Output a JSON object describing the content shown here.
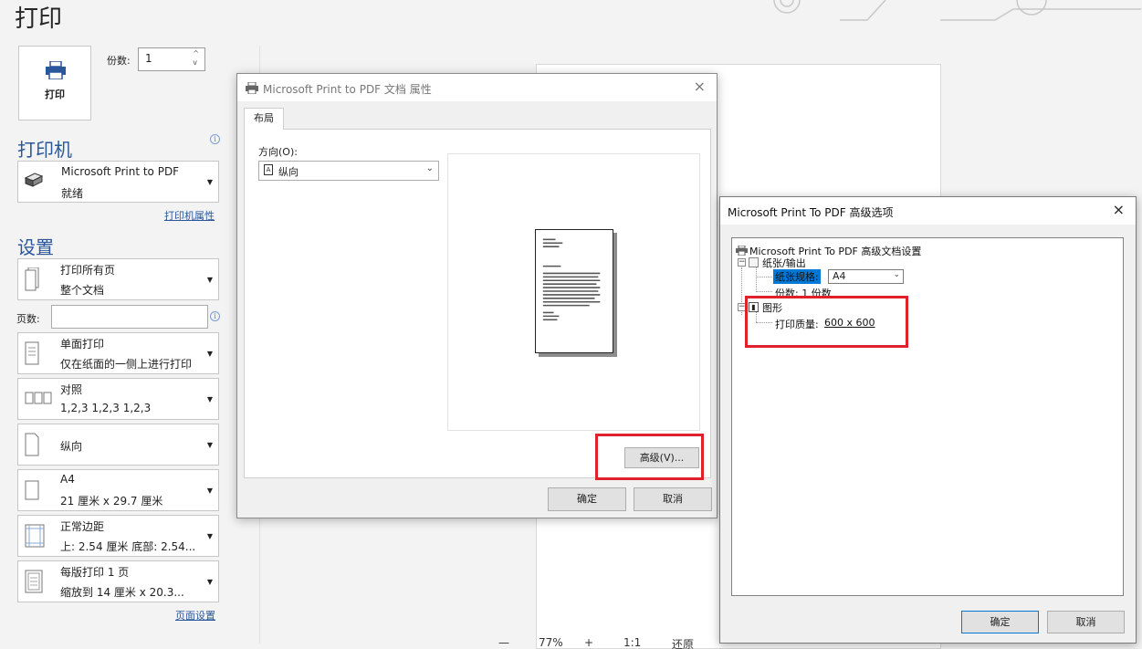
{
  "page": {
    "title": "打印",
    "print_button_label": "打印",
    "copies_label": "份数:",
    "copies_value": "1"
  },
  "printer": {
    "section_title": "打印机",
    "name": "Microsoft Print to PDF",
    "status": "就绪",
    "properties_link": "打印机属性"
  },
  "settings": {
    "section_title": "设置",
    "pages_label": "页数:",
    "pages_value": "",
    "items": [
      {
        "line1": "打印所有页",
        "line2": "整个文档"
      },
      {
        "line1": "单面打印",
        "line2": "仅在纸面的一侧上进行打印"
      },
      {
        "line1": "对照",
        "line2": "1,2,3    1,2,3    1,2,3"
      },
      {
        "line1": "纵向",
        "line2": ""
      },
      {
        "line1": "A4",
        "line2": "21 厘米 x 29.7 厘米"
      },
      {
        "line1": "正常边距",
        "line2": "上: 2.54 厘米 底部: 2.54..."
      },
      {
        "line1": "每版打印 1 页",
        "line2": "缩放到 14 厘米 x 20.3..."
      }
    ],
    "page_setup_link": "页面设置"
  },
  "zoom": {
    "minus": "—",
    "level": "77%",
    "plus": "+",
    "one_to_one": "1:1",
    "restore": "还原"
  },
  "doc_properties_dialog": {
    "title": "Microsoft Print to PDF 文档 属性",
    "close": "×",
    "tab": "布局",
    "orientation_label": "方向(O):",
    "orientation_value": "纵向",
    "advanced_button": "高级(V)...",
    "ok_button": "确定",
    "cancel_button": "取消"
  },
  "advanced_dialog": {
    "title": "Microsoft Print To PDF 高级选项",
    "close": "×",
    "tree_root": "Microsoft Print To PDF 高级文档设置",
    "paper_output": "纸张/输出",
    "paper_size_label": "纸张规格:",
    "paper_size_value": "A4",
    "copies_line": "份数: 1 份数",
    "graphics": "图形",
    "print_quality_label": "打印质量:",
    "print_quality_value": "600 x 600",
    "ok_button": "确定",
    "cancel_button": "取消"
  },
  "colors": {
    "accent_blue": "#2b579a",
    "highlight_red": "#e0202a",
    "selection_blue": "#0078d7"
  }
}
